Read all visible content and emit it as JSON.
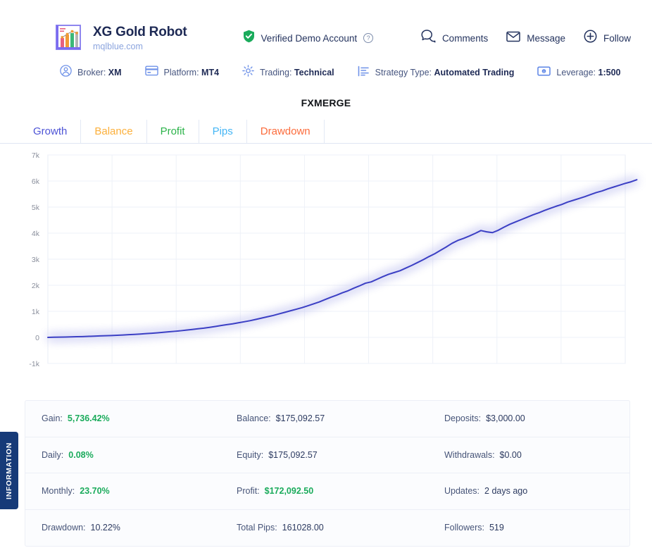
{
  "brand": {
    "title": "XG Gold Robot",
    "subtitle": "mqlblue.com",
    "logo_icon": "bar-chart-logo-icon"
  },
  "verified": {
    "label": "Verified Demo Account",
    "shield_icon": "verified-shield-icon",
    "help_icon": "question-mark-icon",
    "color": "#1aab5b"
  },
  "header_actions": [
    {
      "label": "Comments",
      "icon": "comments-icon"
    },
    {
      "label": "Message",
      "icon": "envelope-icon"
    },
    {
      "label": "Follow",
      "icon": "plus-circle-icon"
    }
  ],
  "meta": [
    {
      "icon": "user-circle-icon",
      "key": "Broker:",
      "value": "XM"
    },
    {
      "icon": "card-icon",
      "key": "Platform:",
      "value": "MT4"
    },
    {
      "icon": "gear-icon",
      "key": "Trading:",
      "value": "Technical"
    },
    {
      "icon": "list-lines-icon",
      "key": "Strategy Type:",
      "value": "Automated Trading"
    },
    {
      "icon": "banknote-icon",
      "key": "Leverage:",
      "value": "1:500"
    }
  ],
  "section_title": "FXMERGE",
  "tabs": [
    {
      "label": "Growth",
      "color": "#4e54d6",
      "active": true
    },
    {
      "label": "Balance",
      "color": "#fcb03c",
      "active": false
    },
    {
      "label": "Profit",
      "color": "#2cb34a",
      "active": false
    },
    {
      "label": "Pips",
      "color": "#45b6f5",
      "active": false
    },
    {
      "label": "Drawdown",
      "color": "#fc6c3c",
      "active": false
    }
  ],
  "chart_data": {
    "type": "line",
    "title": "FXMERGE",
    "xlabel": "",
    "ylabel": "",
    "series_name": "Growth",
    "line_color": "#3b3fc4",
    "glow_color": "#c3c5f0",
    "grid": true,
    "legend_position": "none",
    "ylim": [
      -1000,
      7000
    ],
    "ytick_labels": [
      "7k",
      "6k",
      "5k",
      "4k",
      "3k",
      "2k",
      "1k",
      "0",
      "-1k"
    ],
    "ytick_values": [
      7000,
      6000,
      5000,
      4000,
      3000,
      2000,
      1000,
      0,
      -1000
    ],
    "x_gridline_count": 9,
    "x": [
      0,
      1,
      2,
      3,
      4,
      5,
      6,
      7,
      8,
      9,
      10,
      11,
      12,
      13,
      14,
      15,
      16,
      17,
      18,
      19,
      20,
      21,
      22,
      23,
      24,
      25,
      26,
      27,
      28,
      29,
      30,
      31,
      32,
      33,
      34,
      35,
      36,
      37,
      38,
      39,
      40,
      41,
      42,
      43,
      44,
      45,
      46,
      47,
      48,
      49,
      50,
      51,
      52,
      53,
      54,
      55,
      56,
      57,
      58,
      59,
      60,
      61,
      62,
      63,
      64,
      65,
      66,
      67,
      68,
      69,
      70,
      71,
      72,
      73,
      74,
      75,
      76,
      77,
      78,
      79,
      80,
      81,
      82,
      83,
      84,
      85,
      86,
      87,
      88,
      89,
      90,
      91,
      92,
      93,
      94,
      95,
      96,
      97,
      98,
      99,
      100
    ],
    "values": [
      0,
      5,
      10,
      14,
      20,
      26,
      32,
      40,
      48,
      56,
      64,
      72,
      82,
      92,
      104,
      116,
      130,
      145,
      160,
      175,
      195,
      215,
      235,
      255,
      280,
      305,
      330,
      355,
      385,
      420,
      455,
      490,
      520,
      560,
      600,
      640,
      690,
      740,
      790,
      840,
      900,
      960,
      1020,
      1080,
      1140,
      1210,
      1285,
      1360,
      1450,
      1540,
      1620,
      1710,
      1790,
      1890,
      1980,
      2080,
      2130,
      2230,
      2330,
      2420,
      2490,
      2560,
      2660,
      2760,
      2870,
      2980,
      3100,
      3210,
      3340,
      3470,
      3610,
      3720,
      3800,
      3890,
      3990,
      4100,
      4050,
      4020,
      4110,
      4230,
      4340,
      4430,
      4520,
      4610,
      4700,
      4780,
      4870,
      4950,
      5030,
      5100,
      5190,
      5260,
      5330,
      5400,
      5480,
      5560,
      5620,
      5700,
      5770,
      5840,
      5910,
      5970,
      6050
    ]
  },
  "stats": [
    [
      {
        "key": "Gain:",
        "value": "5,736.42%",
        "positive": true
      },
      {
        "key": "Balance:",
        "value": "$175,092.57",
        "positive": false
      },
      {
        "key": "Deposits:",
        "value": "$3,000.00",
        "positive": false
      }
    ],
    [
      {
        "key": "Daily:",
        "value": "0.08%",
        "positive": true
      },
      {
        "key": "Equity:",
        "value": "$175,092.57",
        "positive": false
      },
      {
        "key": "Withdrawals:",
        "value": "$0.00",
        "positive": false
      }
    ],
    [
      {
        "key": "Monthly:",
        "value": "23.70%",
        "positive": true
      },
      {
        "key": "Profit:",
        "value": "$172,092.50",
        "positive": true
      },
      {
        "key": "Updates:",
        "value": "2 days ago",
        "positive": false
      }
    ],
    [
      {
        "key": "Drawdown:",
        "value": "10.22%",
        "positive": false
      },
      {
        "key": "Total Pips:",
        "value": "161028.00",
        "positive": false
      },
      {
        "key": "Followers:",
        "value": "519",
        "positive": false
      }
    ]
  ],
  "info_tab": {
    "label": "INFORMATION",
    "color": "#163a78"
  }
}
